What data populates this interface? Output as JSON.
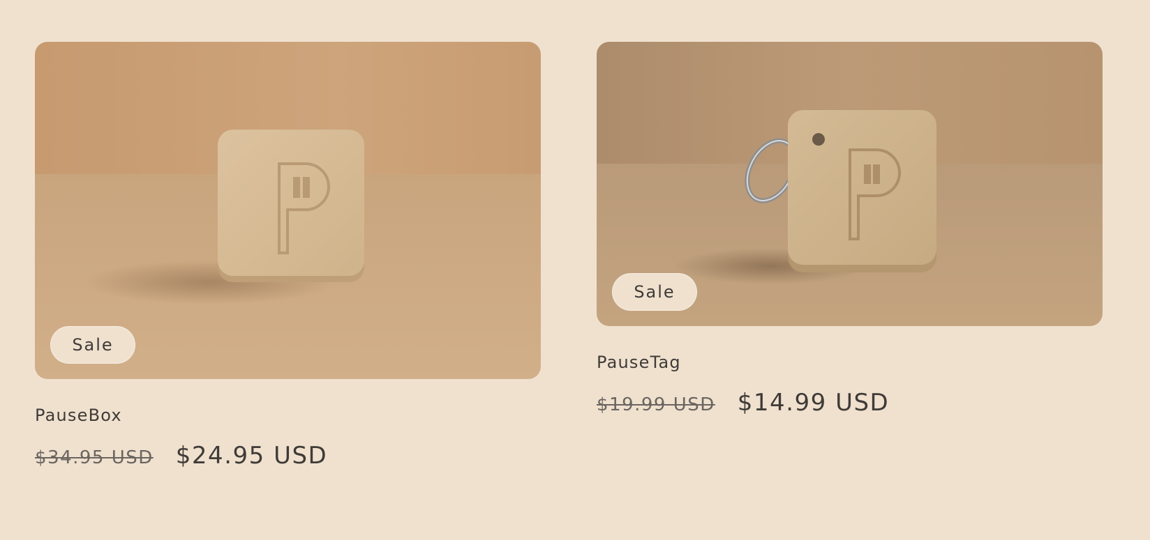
{
  "products": [
    {
      "name": "PauseBox",
      "badge": "Sale",
      "price_original": "$34.95 USD",
      "price_sale": "$24.95 USD",
      "image_icon": "pausebox-product-image"
    },
    {
      "name": "PauseTag",
      "badge": "Sale",
      "price_original": "$19.99 USD",
      "price_sale": "$14.99 USD",
      "image_icon": "pausetag-product-image"
    }
  ],
  "colors": {
    "background": "#f0e1cf",
    "text": "#3f3b37",
    "muted_text": "#6b6560",
    "photo_backdrop": "#c9a47f",
    "product_surface": "#d8bf98"
  }
}
